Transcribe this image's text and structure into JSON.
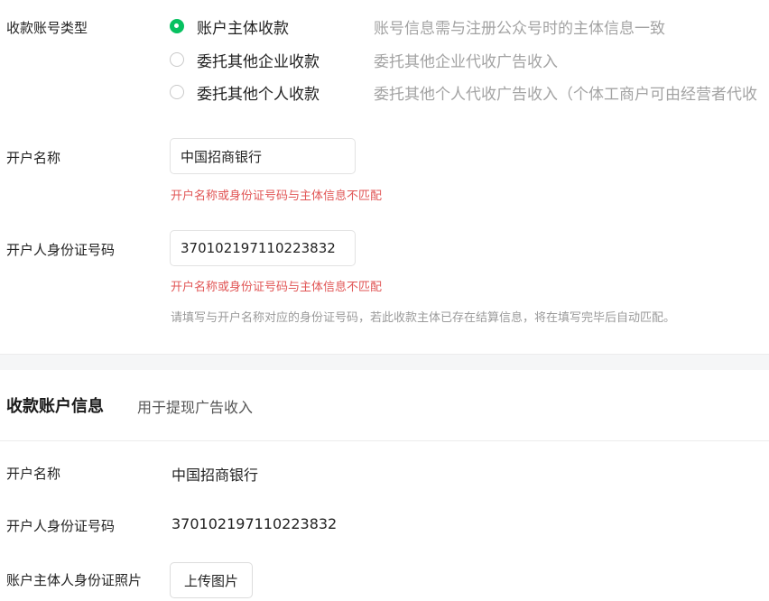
{
  "account_type": {
    "label": "收款账号类型",
    "options": [
      {
        "label": "账户主体收款",
        "desc": "账号信息需与注册公众号时的主体信息一致",
        "checked": true
      },
      {
        "label": "委托其他企业收款",
        "desc": "委托其他企业代收广告收入",
        "checked": false
      },
      {
        "label": "委托其他个人收款",
        "desc": "委托其他个人代收广告收入（个体工商户可由经营者代收",
        "checked": false
      }
    ]
  },
  "form": {
    "account_name": {
      "label": "开户名称",
      "value": "中国招商银行",
      "error": "开户名称或身份证号码与主体信息不匹配"
    },
    "id_number": {
      "label": "开户人身份证号码",
      "value": "370102197110223832",
      "error": "开户名称或身份证号码与主体信息不匹配",
      "hint": "请填写与开户名称对应的身份证号码，若此收款主体已存在结算信息，将在填写完毕后自动匹配。"
    }
  },
  "receiving_account": {
    "title": "收款账户信息",
    "subtitle": "用于提现广告收入",
    "account_name_label": "开户名称",
    "account_name_value": "中国招商银行",
    "id_label": "开户人身份证号码",
    "id_value": "370102197110223832",
    "photo_label": "账户主体人身份证照片",
    "upload_label": "上传图片"
  },
  "colors": {
    "accent": "#07c160",
    "error": "#e15656",
    "muted": "#a3a3a3"
  }
}
